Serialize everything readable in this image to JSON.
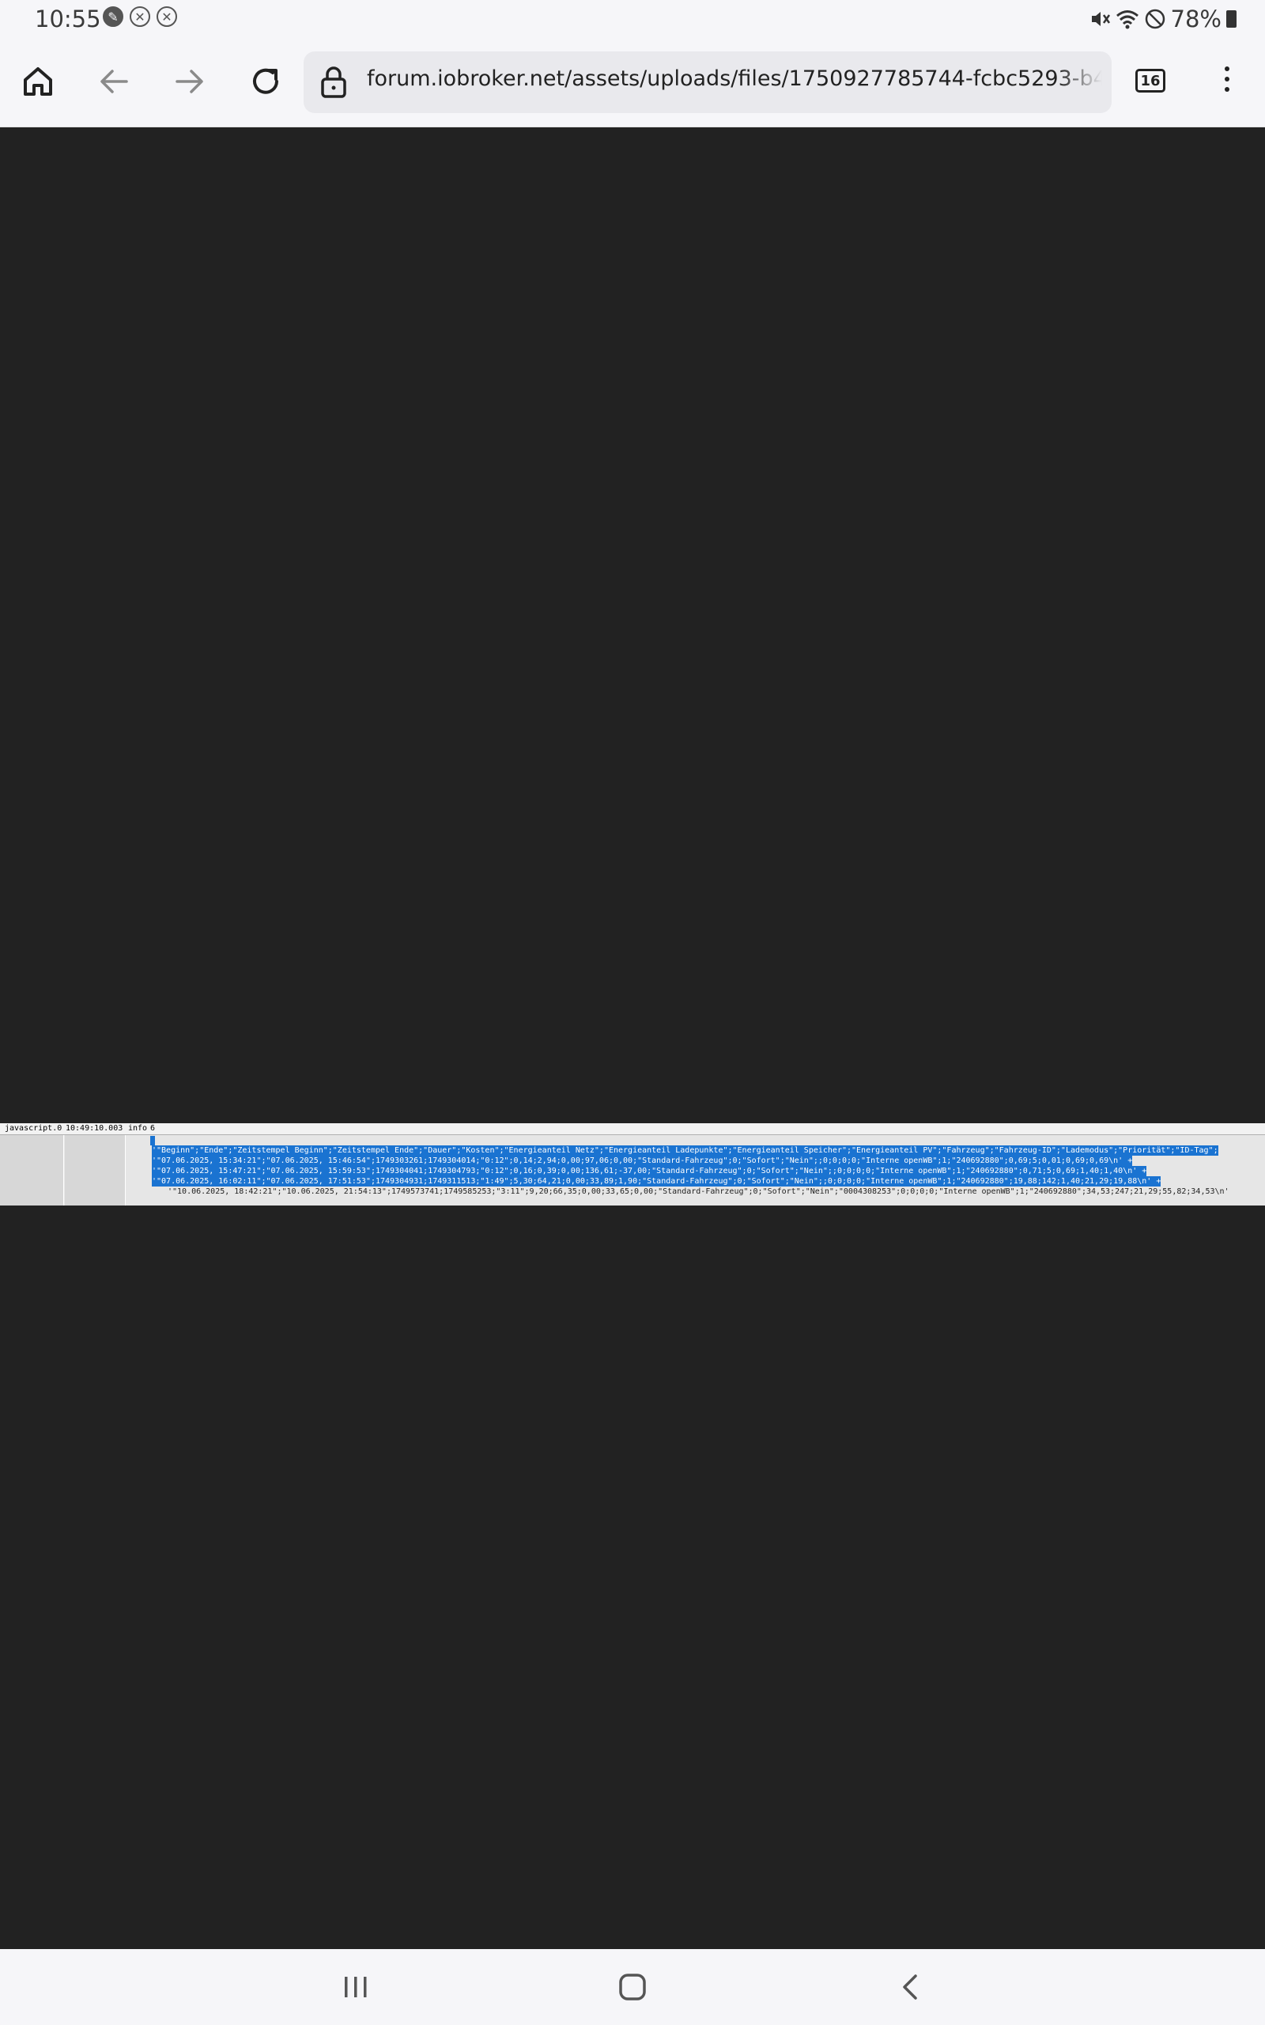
{
  "status_bar": {
    "time": "10:55",
    "battery_text": "78%"
  },
  "browser": {
    "url": "forum.iobroker.net/assets/uploads/files/1750927785744-fcbc5293-b46b-4095",
    "tab_count": "16"
  },
  "log": {
    "source": "javascript.0",
    "time": "10:49:10.003",
    "level": "info",
    "extra": "6",
    "lines": [
      "'\"Beginn\";\"Ende\";\"Zeitstempel Beginn\";\"Zeitstempel Ende\";\"Dauer\";\"Kosten\";\"Energieanteil Netz\";\"Energieanteil Ladepunkte\";\"Energieanteil Speicher\";\"Energieanteil PV\";\"Fahrzeug\";\"Fahrzeug-ID\";\"Lademodus\";\"Priorität\";\"ID-Tag\";",
      "'\"07.06.2025, 15:34:21\";\"07.06.2025, 15:46:54\";1749303261;1749304014;\"0:12\";0,14;2,94;0,00;97,06;0,00;\"Standard-Fahrzeug\";0;\"Sofort\";\"Nein\";;0;0;0;0;\"Interne openWB\";1;\"240692880\";0,69;5;0,01;0,69;0,69\\n' +",
      "'\"07.06.2025, 15:47:21\";\"07.06.2025, 15:59:53\";1749304041;1749304793;\"0:12\";0,16;0,39;0,00;136,61;-37,00;\"Standard-Fahrzeug\";0;\"Sofort\";\"Nein\";;0;0;0;0;\"Interne openWB\";1;\"240692880\";0,71;5;0,69;1,40;1,40\\n' +",
      "'\"07.06.2025, 16:02:11\";\"07.06.2025, 17:51:53\";1749304931;1749311513;\"1:49\";5,30;64,21;0,00;33,89;1,90;\"Standard-Fahrzeug\";0;\"Sofort\";\"Nein\";;0;0;0;0;\"Interne openWB\";1;\"240692880\";19,88;142;1,40;21,29;19,88\\n' +",
      "'\"10.06.2025, 18:42:21\";\"10.06.2025, 21:54:13\";1749573741;1749585253;\"3:11\";9,20;66,35;0,00;33,65;0,00;\"Standard-Fahrzeug\";0;\"Sofort\";\"Nein\";\"0004308253\";0;0;0;0;\"Interne openWB\";1;\"240692880\";34,53;247;21,29;55,82;34,53\\n'"
    ]
  },
  "colors": {
    "background": "#222222",
    "chrome": "#f6f6f9",
    "selection": "#1a73d1"
  }
}
